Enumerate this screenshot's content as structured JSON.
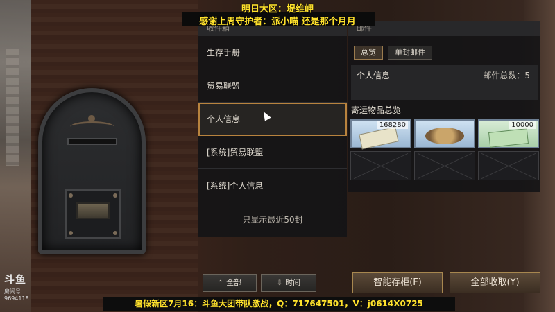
{
  "overlay": {
    "top_line1": "明日大区：堤维岬",
    "top_line2": "感谢上周守护者：派小喵 还是那个月月",
    "bottom_line": "暑假新区7月16：斗鱼大团带队激战，Q：717647501，V：j0614X0725"
  },
  "watermark": {
    "logo": "斗鱼",
    "room_label": "房间号",
    "room_number": "9694118"
  },
  "left_panel": {
    "header": "收件箱",
    "items": [
      {
        "label": "生存手册"
      },
      {
        "label": "贸易联盟"
      },
      {
        "label": "个人信息",
        "active": true
      },
      {
        "label": "[系统]贸易联盟"
      },
      {
        "label": "[系统]个人信息"
      }
    ],
    "note": "只显示最近50封",
    "buttons": {
      "all": "全部",
      "time": "时间"
    }
  },
  "right_panel": {
    "header": "邮件",
    "tabs": [
      "总览",
      "单封邮件"
    ],
    "active_tab": "总览",
    "info_title": "个人信息",
    "mail_count": "邮件总数：5",
    "section_title": "寄运物品总览",
    "items": [
      {
        "qty": "168280",
        "icon": "note-icon"
      },
      {
        "qty": "",
        "icon": "grilled-fish-icon"
      },
      {
        "qty": "10000",
        "icon": "banknote-icon"
      }
    ],
    "buttons": {
      "smart_store": "智能存柜(F)",
      "collect_all": "全部收取(Y)"
    }
  },
  "colors": {
    "accent": "#b8833e",
    "overlay_text": "#ffe22c"
  }
}
